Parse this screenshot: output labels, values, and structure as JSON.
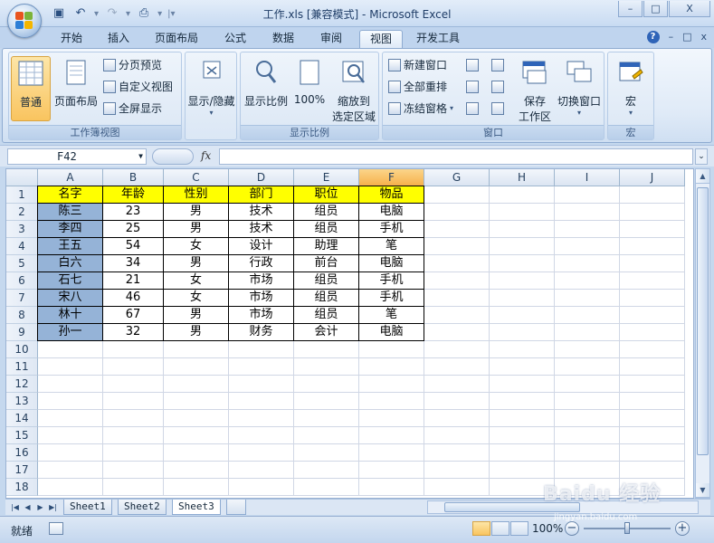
{
  "window": {
    "title": "工作.xls  [兼容模式] - Microsoft Excel",
    "minimize": "–",
    "maximize": "□",
    "close": "X"
  },
  "ribbon_tabs": [
    "开始",
    "插入",
    "页面布局",
    "公式",
    "数据",
    "审阅",
    "视图",
    "开发工具"
  ],
  "active_tab": "视图",
  "ribbon_right": {
    "help": "?",
    "min": "–",
    "restore": "□",
    "close": "x"
  },
  "groups": {
    "workbook_views": {
      "label": "工作簿视图",
      "normal": "普通",
      "page_layout": "页面布局",
      "page_break": "分页预览",
      "custom_views": "自定义视图",
      "full_screen": "全屏显示"
    },
    "show_hide": {
      "label": "显示/隐藏"
    },
    "zoom": {
      "label": "显示比例",
      "zoom": "显示比例",
      "zoom100": "100%",
      "zoom_sel_l1": "缩放到",
      "zoom_sel_l2": "选定区域"
    },
    "window": {
      "label": "窗口",
      "new_window": "新建窗口",
      "arrange_all": "全部重排",
      "freeze_panes": "冻结窗格",
      "save_ws_l1": "保存",
      "save_ws_l2": "工作区",
      "switch_windows": "切换窗口"
    },
    "macros": {
      "label": "宏",
      "macros": "宏"
    }
  },
  "formula_bar": {
    "name_box": "F42",
    "fx": "fx",
    "formula": ""
  },
  "columns": [
    "A",
    "B",
    "C",
    "D",
    "E",
    "F",
    "G",
    "H",
    "I",
    "J"
  ],
  "selected_column": "F",
  "rows": [
    "1",
    "2",
    "3",
    "4",
    "5",
    "6",
    "7",
    "8",
    "9",
    "10",
    "11",
    "12",
    "13",
    "14",
    "15",
    "16",
    "17",
    "18"
  ],
  "table": {
    "headers": [
      "名字",
      "年龄",
      "性别",
      "部门",
      "职位",
      "物品"
    ],
    "data": [
      [
        "陈三",
        "23",
        "男",
        "技术",
        "组员",
        "电脑"
      ],
      [
        "李四",
        "25",
        "男",
        "技术",
        "组员",
        "手机"
      ],
      [
        "王五",
        "54",
        "女",
        "设计",
        "助理",
        "笔"
      ],
      [
        "白六",
        "34",
        "男",
        "行政",
        "前台",
        "电脑"
      ],
      [
        "石七",
        "21",
        "女",
        "市场",
        "组员",
        "手机"
      ],
      [
        "宋八",
        "46",
        "女",
        "市场",
        "组员",
        "手机"
      ],
      [
        "林十",
        "67",
        "男",
        "市场",
        "组员",
        "笔"
      ],
      [
        "孙一",
        "32",
        "男",
        "财务",
        "会计",
        "电脑"
      ]
    ]
  },
  "sheet_tabs": [
    "Sheet1",
    "Sheet2",
    "Sheet3"
  ],
  "active_sheet": "Sheet3",
  "status": {
    "ready": "就绪",
    "zoom": "100%"
  },
  "watermark": {
    "brand": "Baidu 经验",
    "url": "jingyan.baidu.com"
  }
}
